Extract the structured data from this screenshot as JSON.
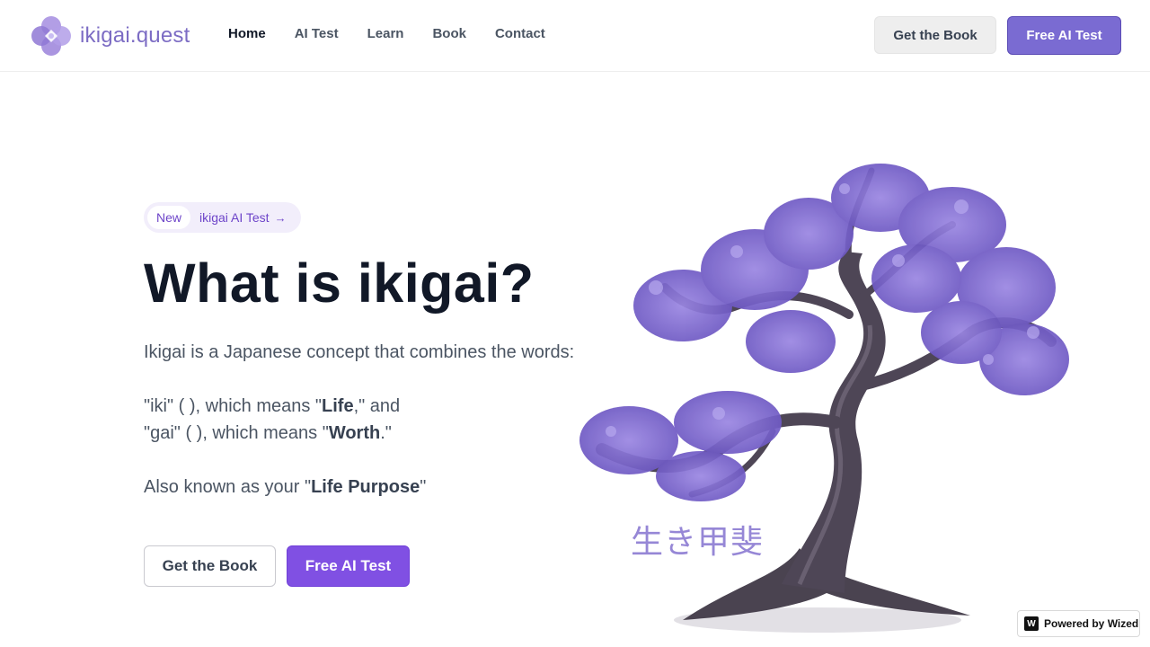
{
  "header": {
    "logo_text": "ikigai.quest",
    "nav": [
      {
        "label": "Home",
        "active": true
      },
      {
        "label": "AI Test",
        "active": false
      },
      {
        "label": "Learn",
        "active": false
      },
      {
        "label": "Book",
        "active": false
      },
      {
        "label": "Contact",
        "active": false
      }
    ],
    "book_button": "Get the Book",
    "test_button": "Free AI Test"
  },
  "hero": {
    "badge_new": "New",
    "badge_link": "ikigai AI Test",
    "badge_arrow": "→",
    "title": "What is ikigai?",
    "intro": "Ikigai is a Japanese concept that combines the words:",
    "iki_prefix": "\"iki\" (  ), which means \"",
    "iki_word": "Life",
    "iki_suffix": ",\" and",
    "gai_prefix": "\"gai\" (  ), which means \"",
    "gai_word": "Worth",
    "gai_suffix": ".\"",
    "aka_prefix": "Also known as your \"",
    "aka_word": "Life Purpose",
    "aka_suffix": "\"",
    "book_button": "Get the Book",
    "test_button": "Free AI Test",
    "kanji": "生き甲斐"
  },
  "footer_badge": {
    "label": "Powered by Wized",
    "icon": "W"
  },
  "colors": {
    "brand": "#7c6cc4",
    "primary_button": "#8050e3",
    "blossom": "#8a74d8",
    "trunk": "#4a4350"
  },
  "icons": [
    "logo-flower-icon",
    "arrow-right-icon",
    "wized-icon"
  ]
}
